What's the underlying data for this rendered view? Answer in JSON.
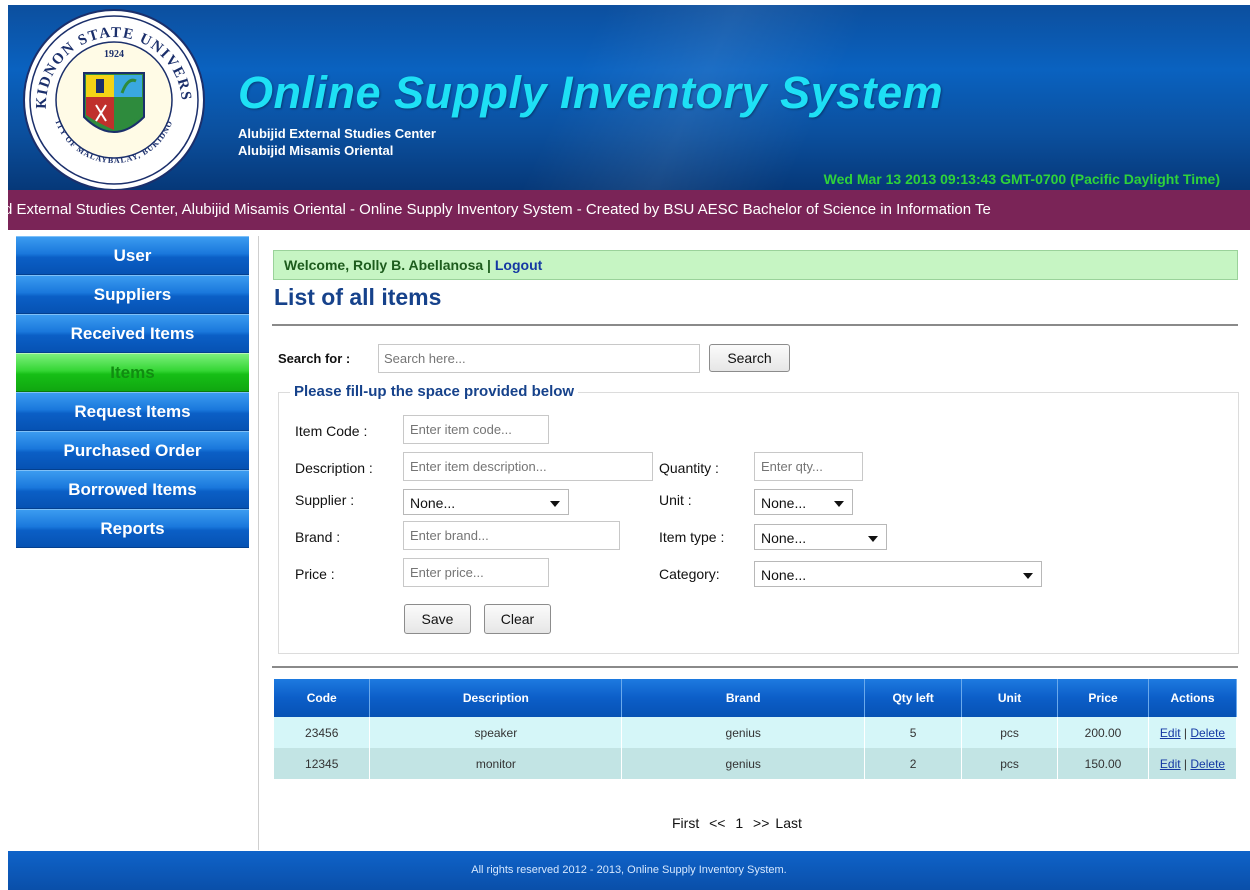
{
  "header": {
    "title": "Online Supply Inventory System",
    "subtitle1": "Alubijid External Studies Center",
    "subtitle2": "Alubijid Misamis Oriental",
    "datetime": "Wed Mar 13 2013 09:13:43 GMT-0700 (Pacific Daylight Time)",
    "logo_text_top": "BUKIDNON STATE UNIVERSITY",
    "logo_text_bottom": "CITY OF MALAYBALAY, BUKIDNON",
    "logo_year": "1924"
  },
  "marquee": "d External Studies Center, Alubijid Misamis Oriental - Online Supply Inventory System - Created by BSU AESC Bachelor of Science in Information Te",
  "sidebar": {
    "items": [
      {
        "label": "User"
      },
      {
        "label": "Suppliers"
      },
      {
        "label": "Received Items"
      },
      {
        "label": "Items"
      },
      {
        "label": "Request Items"
      },
      {
        "label": "Purchased Order"
      },
      {
        "label": "Borrowed Items"
      },
      {
        "label": "Reports"
      }
    ],
    "active": "Items"
  },
  "welcome": {
    "text": "Welcome, Rolly B. Abellanosa | ",
    "logout": "Logout"
  },
  "page_title": "List of all items",
  "search": {
    "label": "Search for :",
    "placeholder": "Search here...",
    "button": "Search"
  },
  "form": {
    "legend": "Please fill-up the space provided below",
    "item_code": {
      "label": "Item Code :",
      "placeholder": "Enter item code..."
    },
    "description": {
      "label": "Description :",
      "placeholder": "Enter item description..."
    },
    "quantity": {
      "label": "Quantity :",
      "placeholder": "Enter qty..."
    },
    "supplier": {
      "label": "Supplier :",
      "value": "None..."
    },
    "unit": {
      "label": "Unit :",
      "value": "None..."
    },
    "brand": {
      "label": "Brand :",
      "placeholder": "Enter brand..."
    },
    "item_type": {
      "label": "Item type :",
      "value": "None..."
    },
    "price": {
      "label": "Price :",
      "placeholder": "Enter price..."
    },
    "category": {
      "label": "Category:",
      "value": "None..."
    },
    "save": "Save",
    "clear": "Clear"
  },
  "table": {
    "columns": [
      "Code",
      "Description",
      "Brand",
      "Qty left",
      "Unit",
      "Price",
      "Actions"
    ],
    "rows": [
      {
        "code": "23456",
        "description": "speaker",
        "brand": "genius",
        "qty": "5",
        "unit": "pcs",
        "price": "200.00",
        "edit": "Edit",
        "sep": " | ",
        "delete": "Delete"
      },
      {
        "code": "12345",
        "description": "monitor",
        "brand": "genius",
        "qty": "2",
        "unit": "pcs",
        "price": "150.00",
        "edit": "Edit",
        "sep": " | ",
        "delete": "Delete"
      }
    ]
  },
  "pager": {
    "first": "First",
    "prev": "<<",
    "page": "1",
    "next": ">>",
    "last": "Last"
  },
  "footer": "All rights reserved 2012 - 2013, Online Supply Inventory System.",
  "colors": {
    "header_blue": "#0a62c0",
    "title_cyan": "#1ee0f5",
    "datetime_green": "#2fd23a",
    "marquee_bg": "#7a2457",
    "nav_active": "#35d635",
    "welcome_bg": "#c6f5c3"
  }
}
